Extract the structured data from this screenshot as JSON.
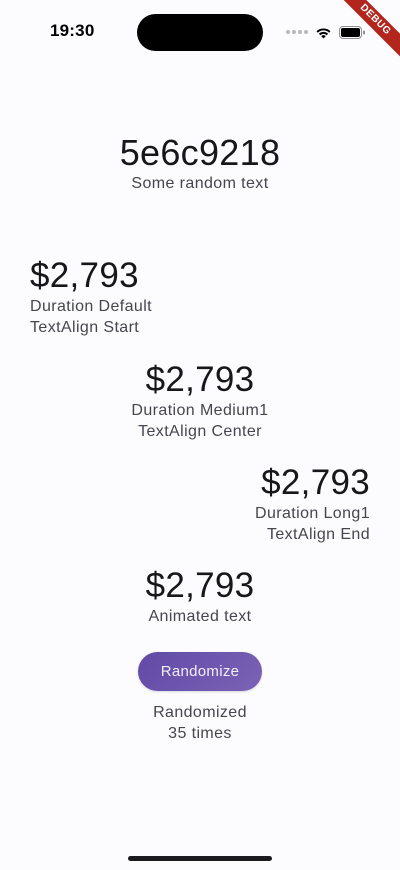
{
  "status_bar": {
    "time": "19:30",
    "debug_label": "DEBUG"
  },
  "hero": {
    "value": "5e6c9218",
    "caption": "Some random text"
  },
  "items": [
    {
      "amount": "$2,793",
      "line1": "Duration Default",
      "line2": "TextAlign Start"
    },
    {
      "amount": "$2,793",
      "line1": "Duration Medium1",
      "line2": "TextAlign Center"
    },
    {
      "amount": "$2,793",
      "line1": "Duration Long1",
      "line2": "TextAlign End"
    }
  ],
  "animated": {
    "amount": "$2,793",
    "caption": "Animated text"
  },
  "randomize": {
    "button_label": "Randomize",
    "counter_line1": "Randomized",
    "counter_line2": "35 times"
  },
  "colors": {
    "button": "#6c55ad",
    "debug_ribbon": "#b3261e",
    "background": "#fcfbfe"
  }
}
